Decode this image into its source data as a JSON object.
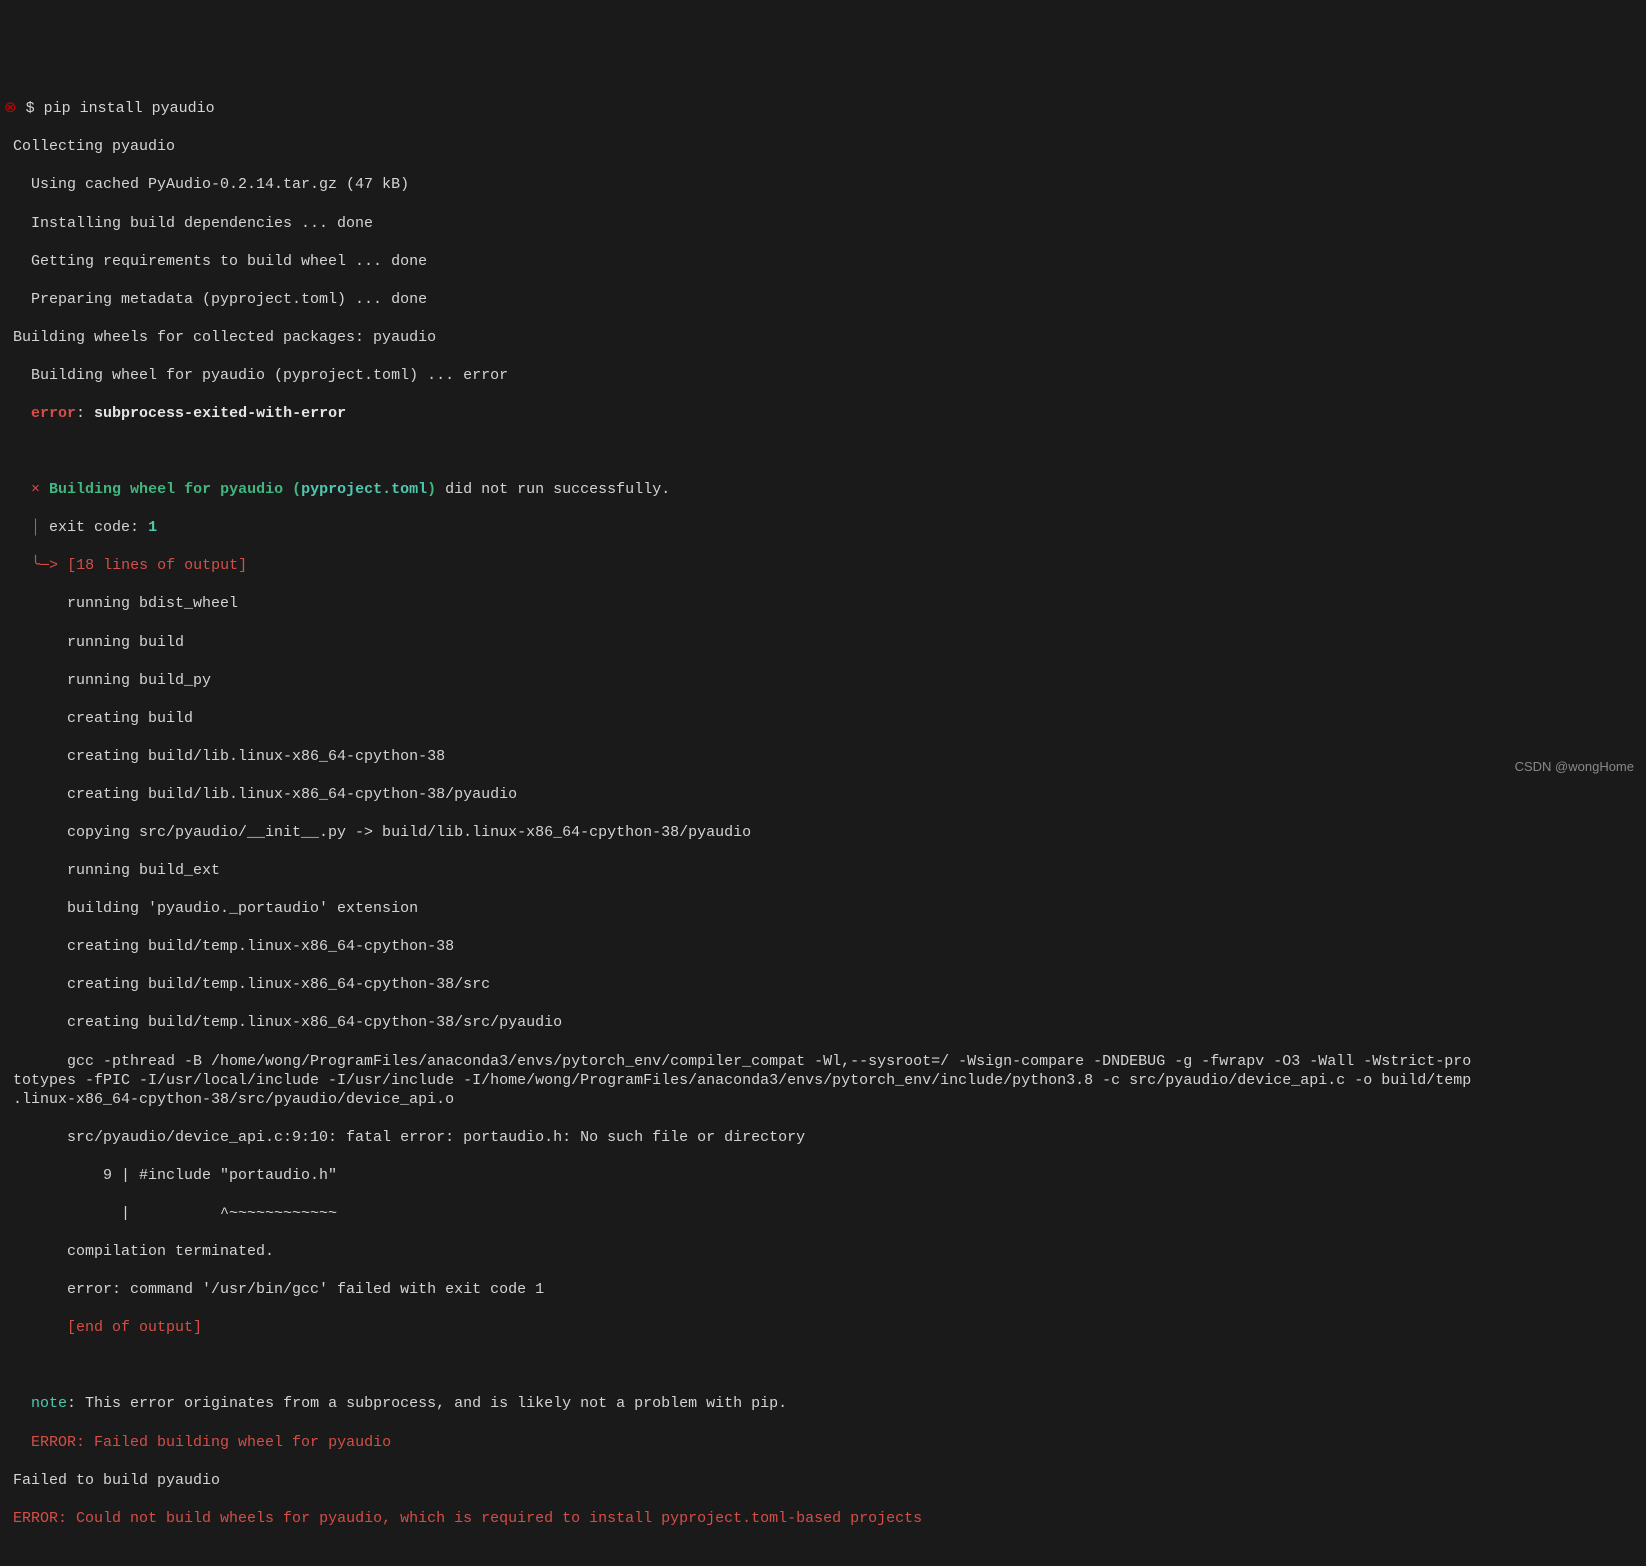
{
  "terminal": {
    "error_icon": "⊗",
    "prompt": " $ ",
    "command": "pip install pyaudio",
    "lines": {
      "l01": " Collecting pyaudio",
      "l02": "   Using cached PyAudio-0.2.14.tar.gz (47 kB)",
      "l03": "   Installing build dependencies ... done",
      "l04": "   Getting requirements to build wheel ... done",
      "l05": "   Preparing metadata (pyproject.toml) ... done",
      "l06": " Building wheels for collected packages: pyaudio",
      "l07": "   Building wheel for pyaudio (pyproject.toml) ... error",
      "l08a": "   ",
      "l08b": "error",
      "l08c": ": ",
      "l08d": "subprocess-exited-with-error",
      "l09": "   ",
      "l10a": "   ",
      "l10b": "×",
      "l10c": " ",
      "l10d": "Building wheel for pyaudio ",
      "l10e": "(",
      "l10f": "pyproject.toml",
      "l10g": ")",
      "l10h": " did not run successfully.",
      "l11a": "   ",
      "l11b": "│",
      "l11c": " exit code: ",
      "l11d": "1",
      "l12a": "   ",
      "l12b": "╰─>",
      "l12c": " ",
      "l12d": "[18 lines of output]",
      "l13": "       running bdist_wheel",
      "l14": "       running build",
      "l15": "       running build_py",
      "l16": "       creating build",
      "l17": "       creating build/lib.linux-x86_64-cpython-38",
      "l18": "       creating build/lib.linux-x86_64-cpython-38/pyaudio",
      "l19": "       copying src/pyaudio/__init__.py -> build/lib.linux-x86_64-cpython-38/pyaudio",
      "l20": "       running build_ext",
      "l21": "       building 'pyaudio._portaudio' extension",
      "l22": "       creating build/temp.linux-x86_64-cpython-38",
      "l23": "       creating build/temp.linux-x86_64-cpython-38/src",
      "l24": "       creating build/temp.linux-x86_64-cpython-38/src/pyaudio",
      "l25": "       gcc -pthread -B /home/wong/ProgramFiles/anaconda3/envs/pytorch_env/compiler_compat -Wl,--sysroot=/ -Wsign-compare -DNDEBUG -g -fwrapv -O3 -Wall -Wstrict-pro\n totypes -fPIC -I/usr/local/include -I/usr/include -I/home/wong/ProgramFiles/anaconda3/envs/pytorch_env/include/python3.8 -c src/pyaudio/device_api.c -o build/temp\n .linux-x86_64-cpython-38/src/pyaudio/device_api.o",
      "l26": "       src/pyaudio/device_api.c:9:10: fatal error: portaudio.h: No such file or directory",
      "l27": "           9 | #include \"portaudio.h\"",
      "l28": "             |          ^~~~~~~~~~~~~",
      "l29": "       compilation terminated.",
      "l30": "       error: command '/usr/bin/gcc' failed with exit code 1",
      "l31": "       ",
      "l31b": "[end of output]",
      "l32": "   ",
      "l33a": "   ",
      "l33b": "note",
      "l33c": ": This error originates from a subprocess, and is likely not a problem with pip.",
      "l34a": "   ",
      "l34b": "ERROR: Failed building wheel for pyaudio",
      "l35": " Failed to build pyaudio",
      "l36a": " ",
      "l36b": "ERROR: Could not build wheels for pyaudio, which is required to install pyproject.toml-based projects"
    }
  },
  "watermark": "CSDN @wongHome"
}
